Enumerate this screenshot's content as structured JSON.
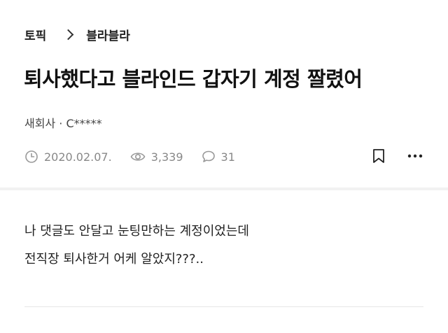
{
  "breadcrumb": {
    "parent": "토픽",
    "current": "블라블라"
  },
  "post": {
    "title": "퇴사했다고 블라인드 갑자기 계정 짤렸어",
    "author_company": "새회사",
    "author_separator": "·",
    "author_name": "C*****",
    "date": "2020.02.07.",
    "views": "3,339",
    "comments": "31",
    "body_lines": [
      "나 댓글도 안달고 눈팅만하는 계정이었는데",
      "전직장 퇴사한거 어케 알았지???.."
    ]
  },
  "icons": {
    "date": "clock-icon",
    "views": "eye-icon",
    "comments": "speech-bubble-icon",
    "bookmark": "bookmark-icon",
    "more": "more-horizontal-icon",
    "breadcrumb_separator": "chevron-right-icon"
  },
  "colors": {
    "text": "#111111",
    "meta": "#888888",
    "divider": "#f2f2f2"
  }
}
